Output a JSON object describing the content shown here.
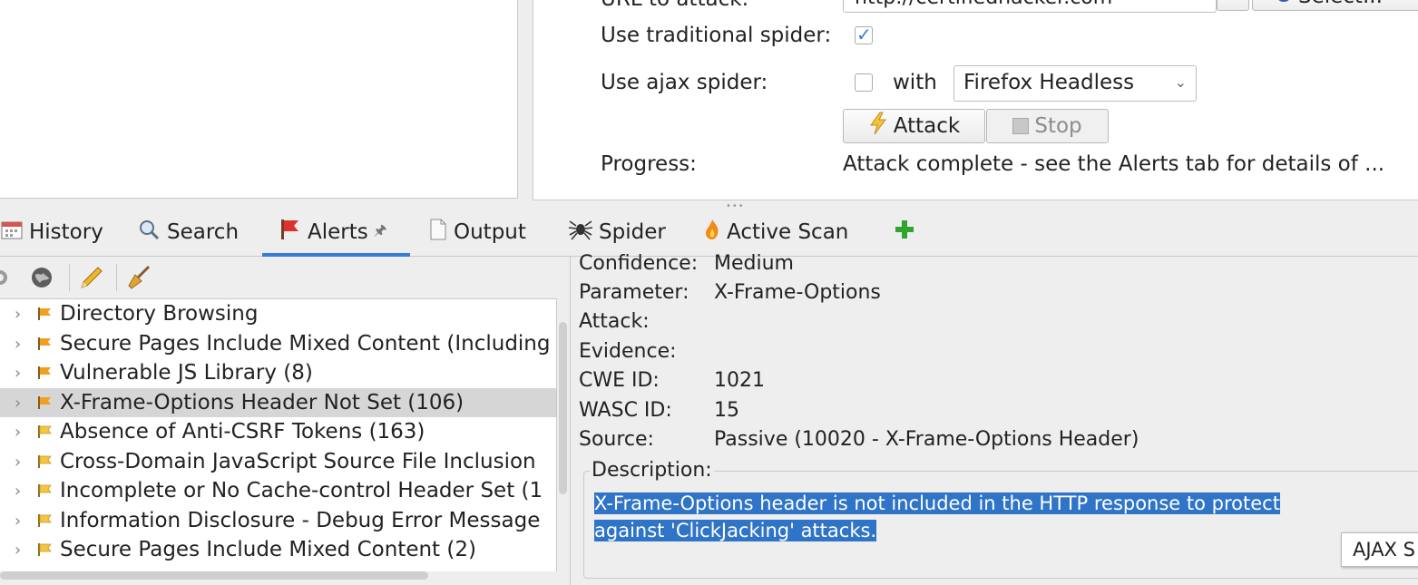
{
  "quick_start": {
    "url_label": "URL to attack:",
    "url_value": "http://certifiedhacker.com",
    "select_label": "Select...",
    "traditional_label": "Use traditional spider:",
    "traditional_checked": true,
    "ajax_label": "Use ajax spider:",
    "ajax_checked": false,
    "with_label": "with",
    "browser_value": "Firefox Headless",
    "attack_label": "Attack",
    "stop_label": "Stop",
    "progress_label": "Progress:",
    "progress_value": "Attack complete - see the Alerts tab for details of ..."
  },
  "tabs": [
    {
      "label": "History",
      "icon": "calendar-icon"
    },
    {
      "label": "Search",
      "icon": "magnifier-icon"
    },
    {
      "label": "Alerts",
      "icon": "red-flag-icon",
      "active": true
    },
    {
      "label": "Output",
      "icon": "document-icon"
    },
    {
      "label": "Spider",
      "icon": "spider-icon"
    },
    {
      "label": "Active Scan",
      "icon": "flame-icon"
    }
  ],
  "alerts": [
    {
      "label": "Directory Browsing",
      "level": "medium"
    },
    {
      "label": "Secure Pages Include Mixed Content (Including",
      "level": "medium"
    },
    {
      "label": "Vulnerable JS Library (8)",
      "level": "medium"
    },
    {
      "label": "X-Frame-Options Header Not Set (106)",
      "level": "medium",
      "selected": true
    },
    {
      "label": "Absence of Anti-CSRF Tokens (163)",
      "level": "low"
    },
    {
      "label": "Cross-Domain JavaScript Source File Inclusion",
      "level": "low"
    },
    {
      "label": "Incomplete or No Cache-control Header Set (1",
      "level": "low"
    },
    {
      "label": "Information Disclosure - Debug Error Message",
      "level": "low"
    },
    {
      "label": "Secure Pages Include Mixed Content (2)",
      "level": "low"
    }
  ],
  "detail": {
    "confidence_label": "Confidence:",
    "confidence_value": "Medium",
    "parameter_label": "Parameter:",
    "parameter_value": "X-Frame-Options",
    "attack_label": "Attack:",
    "evidence_label": "Evidence:",
    "cwe_label": "CWE ID:",
    "cwe_value": "1021",
    "wasc_label": "WASC ID:",
    "wasc_value": "15",
    "source_label": "Source:",
    "source_value": "Passive (10020 - X-Frame-Options Header)",
    "description_title": "Description:",
    "description_line1": "X-Frame-Options header is not included in the HTTP response to protect",
    "description_line2": "against 'ClickJacking' attacks."
  },
  "tooltip": "AJAX S",
  "colors": {
    "accent": "#3a7bd5",
    "selection": "#2f74c6",
    "flag_medium": "#f0a020",
    "flag_low": "#f5c542",
    "flag_red": "#d9342b"
  }
}
